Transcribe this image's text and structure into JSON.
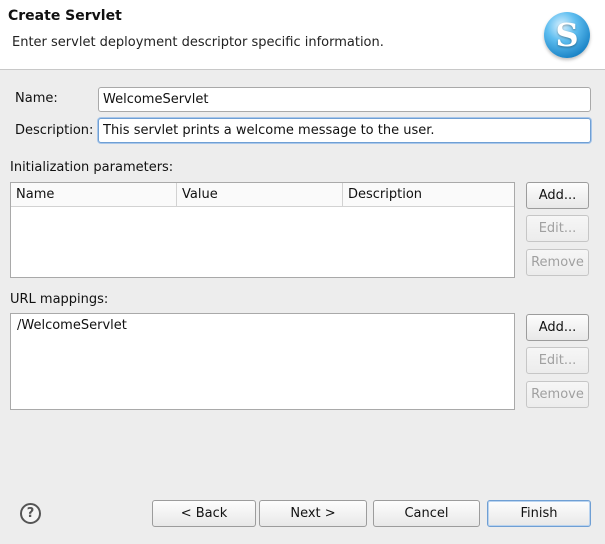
{
  "header": {
    "title": "Create Servlet",
    "subtitle": "Enter servlet deployment descriptor specific information.",
    "logo_letter": "S"
  },
  "form": {
    "name_label": "Name:",
    "name_value": "WelcomeServlet",
    "description_label": "Description:",
    "description_value": "This servlet prints a welcome message to the user."
  },
  "init_params": {
    "label": "Initialization parameters:",
    "columns": [
      "Name",
      "Value",
      "Description"
    ],
    "rows": [],
    "add_label": "Add...",
    "edit_label": "Edit...",
    "remove_label": "Remove"
  },
  "url_mappings": {
    "label": "URL mappings:",
    "items": [
      "/WelcomeServlet"
    ],
    "add_label": "Add...",
    "edit_label": "Edit...",
    "remove_label": "Remove"
  },
  "footer": {
    "help_glyph": "?",
    "back_label": "< Back",
    "next_label": "Next >",
    "cancel_label": "Cancel",
    "finish_label": "Finish"
  }
}
